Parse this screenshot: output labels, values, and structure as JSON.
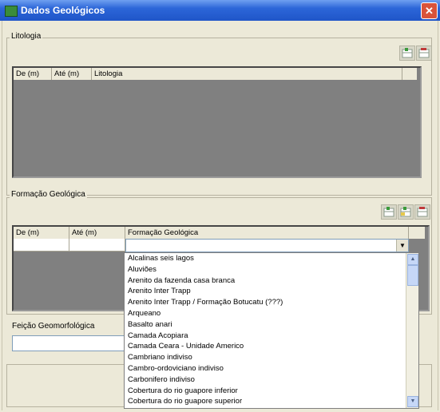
{
  "window": {
    "title": "Dados Geológicos",
    "close_glyph": "✕",
    "app_icon": "grid-icon"
  },
  "litologia": {
    "group_label": "Litologia",
    "buttons": [
      {
        "icon": "add-row-icon"
      },
      {
        "icon": "remove-row-icon"
      }
    ],
    "columns": [
      "De (m)",
      "Até (m)",
      "Litologia"
    ]
  },
  "formacao": {
    "group_label": "Formação Geológica",
    "buttons": [
      {
        "icon": "add-row-icon"
      },
      {
        "icon": "insert-row-icon"
      },
      {
        "icon": "remove-row-icon"
      }
    ],
    "columns": [
      "De (m)",
      "Até (m)",
      "Formação Geológica"
    ],
    "combo_value": "",
    "dropdown_glyph": "▼",
    "options": [
      "Alcalinas seis lagos",
      "Aluviões",
      "Arenito da fazenda casa branca",
      "Arenito Inter Trapp",
      "Arenito Inter Trapp / Formação Botucatu (???)",
      "Arqueano",
      "Basalto anari",
      "Camada Acopiara",
      "Camada Ceara - Unidade Americo",
      "Cambriano indiviso",
      "Cambro-ordoviciano indiviso",
      "Carbonifero indiviso",
      "Cobertura do rio guapore inferior",
      "Cobertura do rio guapore superior"
    ],
    "scroll_up_glyph": "▲",
    "scroll_down_glyph": "▼"
  },
  "feicao": {
    "label": "Feição Geomorfológica",
    "value": ""
  },
  "colors": {
    "titlebar": "#2c66d8",
    "grid_bg": "#808080",
    "window_bg": "#ece9d8"
  }
}
